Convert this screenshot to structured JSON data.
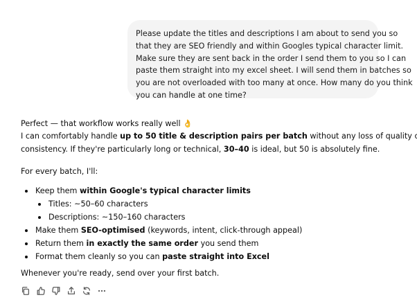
{
  "user_message": {
    "lines": [
      "Please update the titles and descriptions I am about to send you so",
      "that they are SEO friendly and within Googles typical character limit.",
      "Make sure they are sent back in the order I send them to you so I can",
      "paste them straight into my excel sheet. I will send them in batches so",
      "you are not overloaded with too many at once. How many do you think",
      "you can handle at one time?"
    ]
  },
  "assistant_message": {
    "intro": "Perfect — that workflow works really well",
    "intro_emoji": "👌",
    "capacity_line1_pre": "I can comfortably handle ",
    "capacity_line1_bold": "up to 50 title & description pairs per batch",
    "capacity_line1_post": " without any loss of quality or",
    "capacity_line2_pre": "consistency. If they're particularly long or technical, ",
    "capacity_line2_bold": "30–40",
    "capacity_line2_post": " is ideal, but 50 is absolutely fine.",
    "batch_intro": "For every batch, I'll:",
    "bullets": {
      "b1_pre": "Keep them ",
      "b1_bold": "within Google's typical character limits",
      "sub1": "Titles: ~50–60 characters",
      "sub2": "Descriptions: ~150–160 characters",
      "b2_pre": "Make them ",
      "b2_bold": "SEO-optimised",
      "b2_post": " (keywords, intent, click-through appeal)",
      "b3_pre": "Return them ",
      "b3_bold": "in exactly the same order",
      "b3_post": " you send them",
      "b4_pre": "Format them cleanly so you can ",
      "b4_bold": "paste straight into Excel"
    },
    "closing": "Whenever you're ready, send over your first batch."
  },
  "toolbar": {
    "icons": [
      "copy-icon",
      "thumbs-up-icon",
      "thumbs-down-icon",
      "share-icon",
      "regenerate-icon",
      "more-icon"
    ]
  }
}
